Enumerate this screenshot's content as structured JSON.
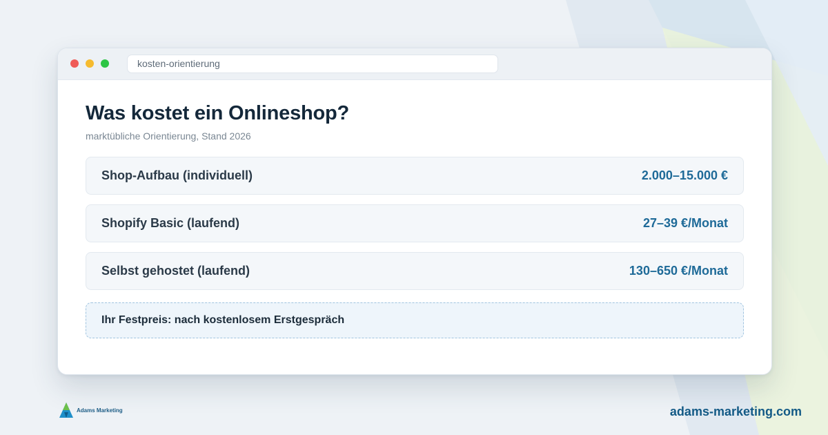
{
  "window": {
    "url": "kosten-orientierung"
  },
  "main": {
    "title": "Was kostet ein Onlineshop?",
    "subtitle": "marktübliche Orientierung, Stand 2026",
    "rows": [
      {
        "label": "Shop-Aufbau (individuell)",
        "price": "2.000–15.000 €"
      },
      {
        "label": "Shopify Basic (laufend)",
        "price": "27–39 €/Monat"
      },
      {
        "label": "Selbst gehostet (laufend)",
        "price": "130–650 €/Monat"
      }
    ],
    "note": "Ihr Festpreis: nach kostenlosem Erstgespräch"
  },
  "footer": {
    "brand_name": "Adams Marketing",
    "website": "adams-marketing.com"
  },
  "colors": {
    "accent_price": "#1e6a98",
    "title": "#14283a",
    "note_border": "#9fc3df"
  }
}
